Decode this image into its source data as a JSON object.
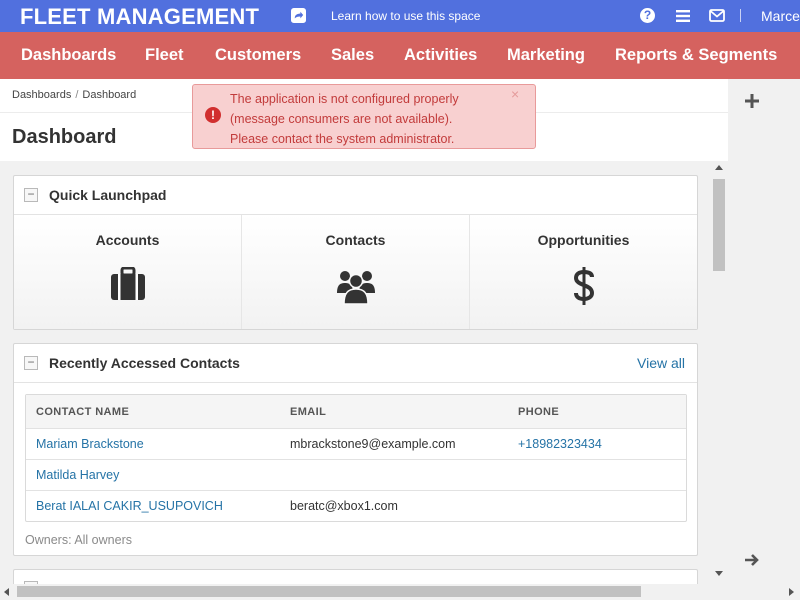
{
  "topbar": {
    "app_title": "FLEET MANAGEMENT",
    "learn_link": "Learn how to use this space",
    "help_glyph": "?",
    "user_name": "Marce",
    "icons": [
      "share-icon",
      "help-icon",
      "menu-icon",
      "mail-icon"
    ],
    "color": "#5170de"
  },
  "navbar": {
    "color": "#d5625f",
    "items": [
      {
        "label": "Dashboards"
      },
      {
        "label": "Fleet"
      },
      {
        "label": "Customers"
      },
      {
        "label": "Sales"
      },
      {
        "label": "Activities"
      },
      {
        "label": "Marketing"
      },
      {
        "label": "Reports & Segments"
      }
    ]
  },
  "breadcrumb": {
    "items": [
      "Dashboards",
      "Dashboard"
    ],
    "separator": "/"
  },
  "page_title": "Dashboard",
  "alert": {
    "lines": [
      "The application is not configured properly",
      "(message consumers are not available).",
      "Please contact the system administrator."
    ],
    "icon_glyph": "!",
    "close_glyph": "×"
  },
  "quick_launchpad": {
    "title": "Quick Launchpad",
    "collapse_glyph": "−",
    "tiles": [
      {
        "label": "Accounts",
        "icon": "briefcase-icon"
      },
      {
        "label": "Contacts",
        "icon": "users-icon"
      },
      {
        "label": "Opportunities",
        "icon": "dollar-icon"
      }
    ]
  },
  "recent_contacts": {
    "title": "Recently Accessed Contacts",
    "collapse_glyph": "−",
    "view_all": "View all",
    "columns": [
      "CONTACT NAME",
      "EMAIL",
      "PHONE"
    ],
    "rows": [
      {
        "name": "Mariam Brackstone",
        "email": "mbrackstone9@example.com",
        "phone": "+18982323434"
      },
      {
        "name": "Matilda Harvey",
        "email": "",
        "phone": ""
      },
      {
        "name": "Berat IALAI CAKIR_USUPOVICH",
        "email": "beratc@xbox1.com",
        "phone": ""
      }
    ],
    "owners": "Owners: All owners"
  },
  "sidebar_icons": [
    "plus-icon",
    "arrow-right-icon"
  ]
}
